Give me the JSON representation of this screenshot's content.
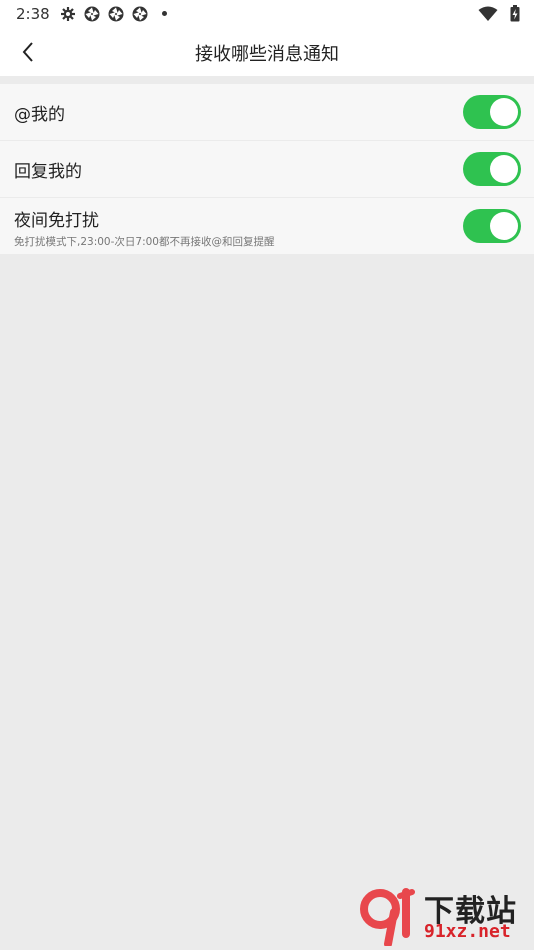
{
  "status_bar": {
    "time": "2:38"
  },
  "header": {
    "title": "接收哪些消息通知"
  },
  "settings": [
    {
      "label": "@我的",
      "description": "",
      "enabled": true
    },
    {
      "label": "回复我的",
      "description": "",
      "enabled": true
    },
    {
      "label": "夜间免打扰",
      "description": "免打扰模式下,23:00-次日7:00都不再接收@和回复提醒",
      "enabled": true
    }
  ],
  "watermark": {
    "brand": "下载站",
    "domain": "91xz.net"
  },
  "colors": {
    "toggle_on": "#2fc250",
    "background": "#ebebeb",
    "list_background": "#f7f7f7"
  }
}
